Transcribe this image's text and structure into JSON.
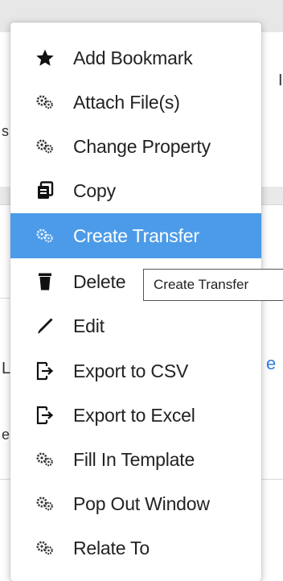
{
  "menu": {
    "items": [
      {
        "label": "Add Bookmark",
        "icon": "star-icon"
      },
      {
        "label": "Attach File(s)",
        "icon": "gears-icon"
      },
      {
        "label": "Change Property",
        "icon": "gears-icon"
      },
      {
        "label": "Copy",
        "icon": "copy-icon"
      },
      {
        "label": "Create Transfer",
        "icon": "gears-icon",
        "highlighted": true
      },
      {
        "label": "Delete",
        "icon": "trash-icon"
      },
      {
        "label": "Edit",
        "icon": "pencil-icon"
      },
      {
        "label": "Export to CSV",
        "icon": "export-icon"
      },
      {
        "label": "Export to Excel",
        "icon": "export-icon"
      },
      {
        "label": "Fill In Template",
        "icon": "gears-icon"
      },
      {
        "label": "Pop Out Window",
        "icon": "gears-icon"
      },
      {
        "label": "Relate To",
        "icon": "gears-icon"
      }
    ],
    "highlight_color": "#4c9be8"
  },
  "tooltip": {
    "text": "Create Transfer"
  }
}
